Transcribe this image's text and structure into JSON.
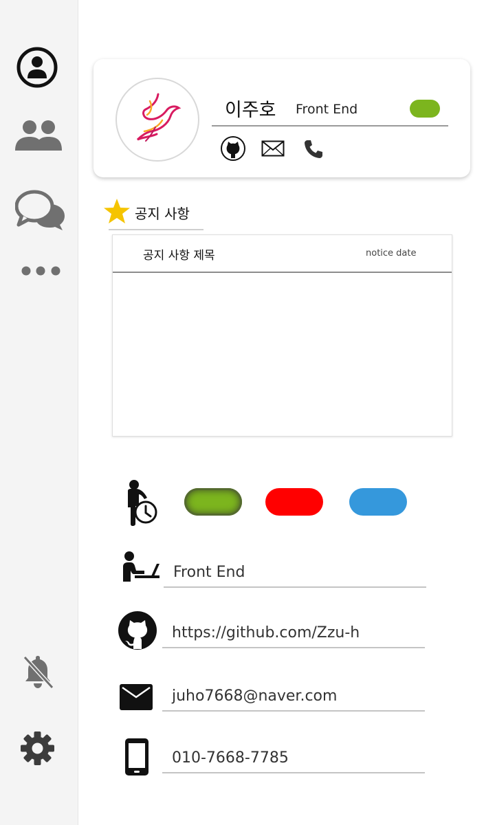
{
  "sidebar": {
    "items": [
      {
        "icon": "profile-circle-icon"
      },
      {
        "icon": "people-icon"
      },
      {
        "icon": "chat-bubbles-icon"
      },
      {
        "icon": "more-dots-icon"
      }
    ],
    "bottom": [
      {
        "icon": "bell-off-icon"
      },
      {
        "icon": "gear-icon"
      }
    ]
  },
  "profile": {
    "name": "이주호",
    "role": "Front End",
    "status_color": "#7cb51e",
    "contacts": [
      "github-icon",
      "mail-icon",
      "phone-icon"
    ]
  },
  "notices": {
    "heading": "공지 사항",
    "header_title": "공지 사항 제목",
    "header_date": "notice date",
    "rows": []
  },
  "status_options": [
    {
      "color": "#7cb51e",
      "selected": true
    },
    {
      "color": "#ff0000",
      "selected": false
    },
    {
      "color": "#3598dc",
      "selected": false
    }
  ],
  "details": {
    "position": "Front End",
    "github": "https://github.com/Zzu-h",
    "email": "juho7668@naver.com",
    "phone": "010-7668-7785"
  }
}
